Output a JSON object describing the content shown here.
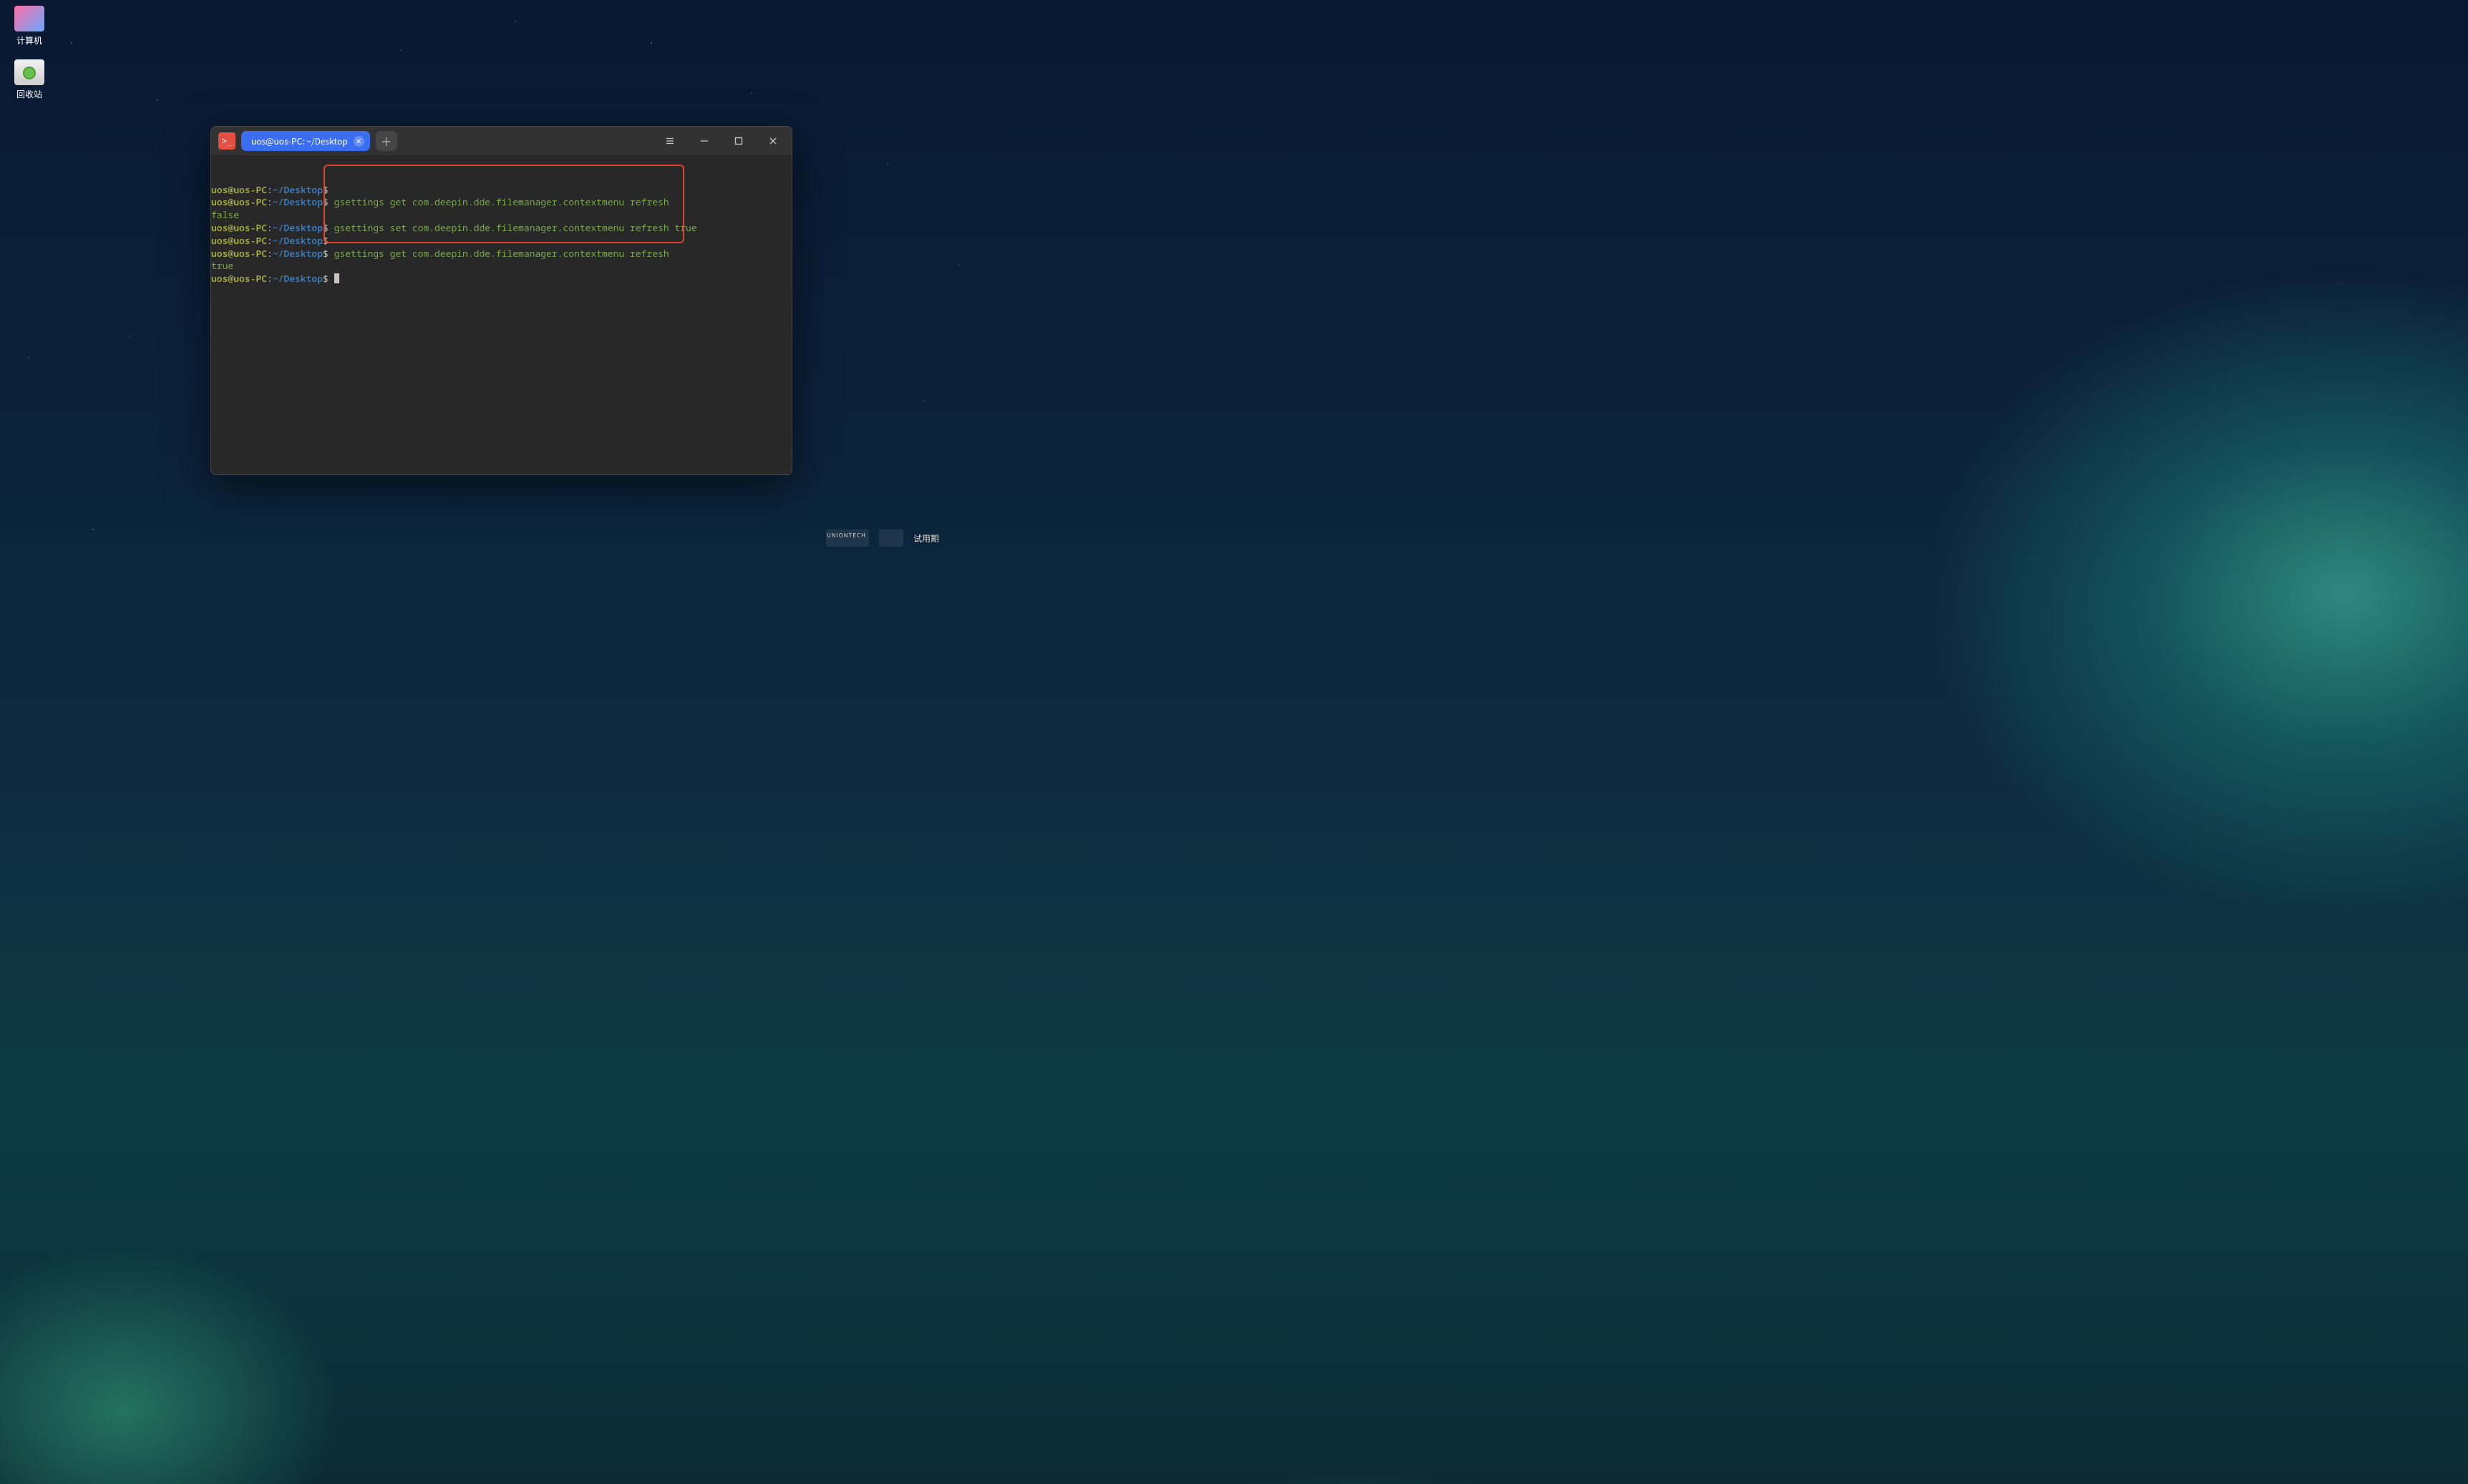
{
  "desktop": {
    "icons": [
      {
        "name": "computer",
        "label": "计算机"
      },
      {
        "name": "trash",
        "label": "回收站"
      }
    ]
  },
  "terminal": {
    "tab_title": "uos@uos-PC: ~/Desktop",
    "prompt": {
      "userhost": "uos@uos-PC",
      "sep": ":",
      "path": "~/Desktop",
      "symbol": "$"
    },
    "lines": [
      {
        "type": "prompt",
        "cmd": ""
      },
      {
        "type": "prompt",
        "cmd": "gsettings get com.deepin.dde.filemanager.contextmenu refresh"
      },
      {
        "type": "output",
        "text": "false"
      },
      {
        "type": "prompt",
        "cmd": "gsettings set com.deepin.dde.filemanager.contextmenu refresh true"
      },
      {
        "type": "prompt",
        "cmd": ""
      },
      {
        "type": "prompt",
        "cmd": "gsettings get com.deepin.dde.filemanager.contextmenu refresh"
      },
      {
        "type": "output",
        "text": "true"
      },
      {
        "type": "prompt",
        "cmd": "",
        "cursor": true
      }
    ]
  },
  "watermark": {
    "brand_text": "UNIONTECH",
    "trial_label": "试用期"
  }
}
